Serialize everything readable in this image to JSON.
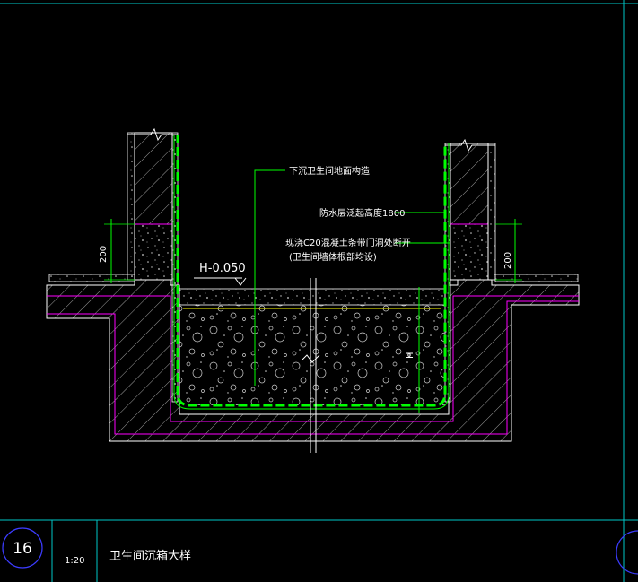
{
  "drawing": {
    "labels": {
      "sunken_floor": "下沉卫生间地面构造",
      "waterproof_height": "防水层泛起高度1800",
      "curb_line1": "现浇C20混凝土条带门洞处断开",
      "curb_line2": "(卫生间墙体根部均设)",
      "elevation": "H-0.050",
      "depth": "H",
      "dim_left": "200",
      "dim_right": "200"
    },
    "title_block": {
      "detail_number": "16",
      "scale": "1:20",
      "title": "卫生间沉箱大样"
    },
    "colors": {
      "background": "#000000",
      "line_white": "#ffffff",
      "waterproof_green": "#00ff00",
      "membrane_magenta": "#ff00ff",
      "border_cyan": "#00c8c8",
      "circle_blue": "#3c3cff",
      "dim_yellow": "#ffff00"
    }
  }
}
